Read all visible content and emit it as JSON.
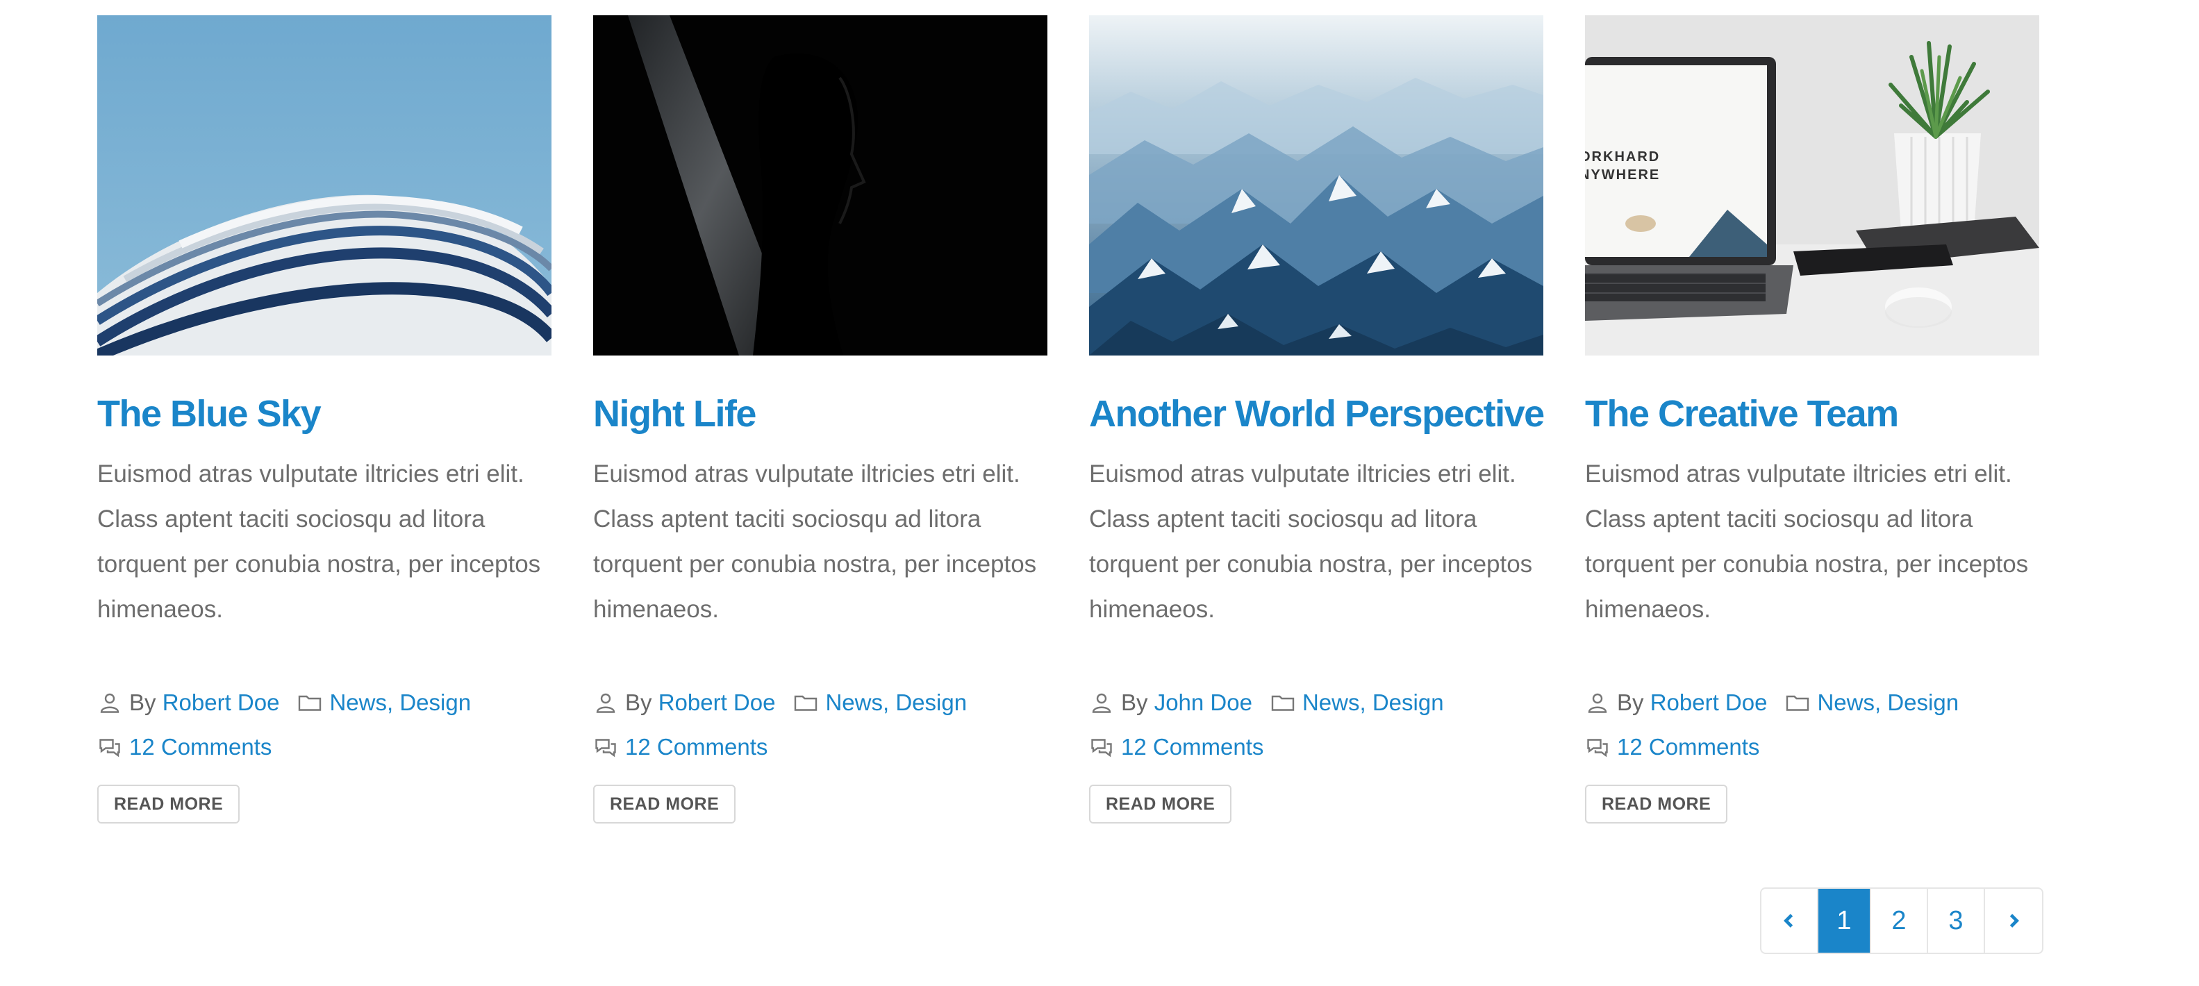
{
  "posts": [
    {
      "title": "The Blue Sky",
      "excerpt": "Euismod atras vulputate iltricies etri elit. Class aptent taciti sociosqu ad litora torquent per conubia nostra, per inceptos himenaeos.",
      "by": "By",
      "author": "Robert Doe",
      "categories": [
        "News",
        "Design"
      ],
      "comments": "12 Comments",
      "read_more": "READ MORE",
      "image_icon": "architecture-photo"
    },
    {
      "title": "Night Life",
      "excerpt": "Euismod atras vulputate iltricies etri elit. Class aptent taciti sociosqu ad litora torquent per conubia nostra, per inceptos himenaeos.",
      "by": "By",
      "author": "Robert Doe",
      "categories": [
        "News",
        "Design"
      ],
      "comments": "12 Comments",
      "read_more": "READ MORE",
      "image_icon": "silhouette-photo"
    },
    {
      "title": "Another World Perspective",
      "excerpt": "Euismod atras vulputate iltricies etri elit. Class aptent taciti sociosqu ad litora torquent per conubia nostra, per inceptos himenaeos.",
      "by": "By",
      "author": "John Doe",
      "categories": [
        "News",
        "Design"
      ],
      "comments": "12 Comments",
      "read_more": "READ MORE",
      "image_icon": "mountains-photo"
    },
    {
      "title": "The Creative Team",
      "excerpt": "Euismod atras vulputate iltricies etri elit. Class aptent taciti sociosqu ad litora torquent per conubia nostra, per inceptos himenaeos.",
      "by": "By",
      "author": "Robert Doe",
      "categories": [
        "News",
        "Design"
      ],
      "comments": "12 Comments",
      "read_more": "READ MORE",
      "image_icon": "laptop-desk-photo",
      "laptop_text": [
        "ORKHARD",
        "NYWHERE"
      ]
    }
  ],
  "pagination": {
    "pages": [
      "1",
      "2",
      "3"
    ],
    "current": "1"
  },
  "colors": {
    "accent": "#1a85c9",
    "text": "#6d6d6d"
  }
}
